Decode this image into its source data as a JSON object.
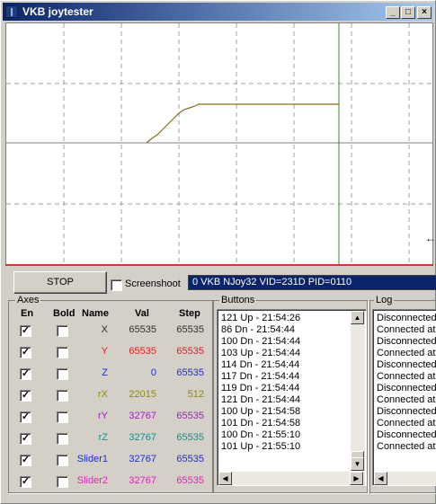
{
  "window": {
    "title": "VKB joytester"
  },
  "titlebar_buttons": {
    "minimize": "_",
    "maximize": "□",
    "close": "×"
  },
  "toolbar": {
    "stop_label": "STOP",
    "screenshot_label": "Screenshoot",
    "screenshot_checked": false,
    "device_value": "0 VKB NJoy32  VID=231D PID=0110"
  },
  "axes": {
    "title": "Axes",
    "headers": {
      "en": "En",
      "bold": "Bold",
      "name": "Name",
      "val": "Val",
      "step": "Step"
    },
    "rows": [
      {
        "en": true,
        "bold": false,
        "name": "X",
        "val": "65535",
        "step": "65535",
        "color": "#303030"
      },
      {
        "en": true,
        "bold": false,
        "name": "Y",
        "val": "65535",
        "step": "65535",
        "color": "#e02020"
      },
      {
        "en": true,
        "bold": false,
        "name": "Z",
        "val": "0",
        "step": "65535",
        "color": "#1a2fd0"
      },
      {
        "en": true,
        "bold": false,
        "name": "rX",
        "val": "22015",
        "step": "512",
        "color": "#8a8a10"
      },
      {
        "en": true,
        "bold": false,
        "name": "rY",
        "val": "32767",
        "step": "65535",
        "color": "#a020c0"
      },
      {
        "en": true,
        "bold": false,
        "name": "rZ",
        "val": "32767",
        "step": "65535",
        "color": "#109090"
      },
      {
        "en": true,
        "bold": false,
        "name": "Slider1",
        "val": "32767",
        "step": "65535",
        "color": "#1a2fd0"
      },
      {
        "en": true,
        "bold": false,
        "name": "Slider2",
        "val": "32767",
        "step": "65535",
        "color": "#e020c0"
      }
    ]
  },
  "buttons_panel": {
    "title": "Buttons",
    "lines": [
      "121 Up - 21:54:26",
      "86 Dn - 21:54:44",
      "100 Dn - 21:54:44",
      "103 Up - 21:54:44",
      "114 Dn - 21:54:44",
      "117 Dn - 21:54:44",
      "119 Dn - 21:54:44",
      "121 Dn - 21:54:44",
      "100 Up - 21:54:58",
      "101 Dn - 21:54:58",
      "100 Dn - 21:55:10",
      "101 Up - 21:55:10"
    ]
  },
  "log_panel": {
    "title": "Log",
    "lines": [
      "Disconnected",
      "Connected at",
      "Disconnected",
      "Connected at",
      "Disconnected",
      "Connected at",
      "Disconnected",
      "Connected at",
      "Disconnected",
      "Connected at",
      "Disconnected",
      "Connected at"
    ]
  },
  "colors": {
    "plot_curve": "#807018",
    "plot_cursor": "#3a8a3a",
    "plot_grid": "#a0a0a0",
    "plot_midline": "#c0c0c0",
    "plot_baseline": "#e03030"
  },
  "icons": {
    "sidearrow": "←"
  }
}
